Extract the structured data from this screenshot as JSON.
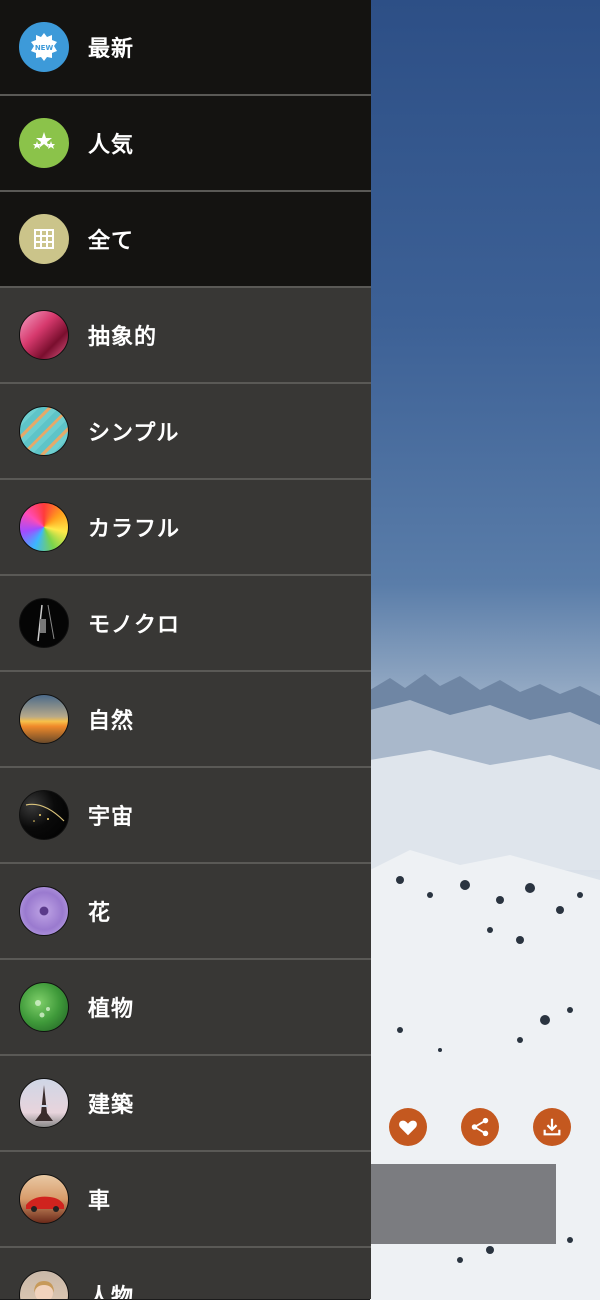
{
  "drawer": {
    "items": [
      {
        "label": "最新",
        "icon": "new-badge-icon"
      },
      {
        "label": "人気",
        "icon": "stars-icon"
      },
      {
        "label": "全て",
        "icon": "grid-icon"
      },
      {
        "label": "抽象的",
        "icon": "abstract-thumbnail"
      },
      {
        "label": "シンプル",
        "icon": "simple-thumbnail"
      },
      {
        "label": "カラフル",
        "icon": "colorful-thumbnail"
      },
      {
        "label": "モノクロ",
        "icon": "monochrome-thumbnail"
      },
      {
        "label": "自然",
        "icon": "nature-thumbnail"
      },
      {
        "label": "宇宙",
        "icon": "space-thumbnail"
      },
      {
        "label": "花",
        "icon": "flower-thumbnail"
      },
      {
        "label": "植物",
        "icon": "plant-thumbnail"
      },
      {
        "label": "建築",
        "icon": "architecture-thumbnail"
      },
      {
        "label": "車",
        "icon": "car-thumbnail"
      },
      {
        "label": "人物",
        "icon": "person-thumbnail"
      }
    ]
  },
  "badge_new": "NEW",
  "actions": [
    {
      "icon": "heart-icon"
    },
    {
      "icon": "share-icon"
    },
    {
      "icon": "download-icon"
    }
  ],
  "colors": {
    "drawer_top": "#141311",
    "drawer_body": "#383735",
    "action_accent": "#c4581f"
  }
}
